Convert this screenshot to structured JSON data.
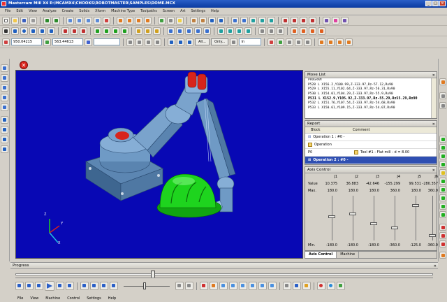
{
  "window": {
    "title": "Mastercam Mill X4   E:\\MCAMX4\\CHOOKS\\ROBOTMASTER\\SAMPLES\\DOME.MCX"
  },
  "menu": [
    "File",
    "Edit",
    "View",
    "Analyze",
    "Create",
    "Solids",
    "Xform",
    "Machine Type",
    "Toolpaths",
    "Screen",
    "Art",
    "Settings",
    "Help"
  ],
  "toolbar": {
    "coord_x": "950.04215",
    "coord_y": "563.44613",
    "field_all": "All...",
    "field_only": "Only...",
    "field_in": "In"
  },
  "movelist": {
    "title": "Move List",
    "header": "PROGRAM",
    "lines": [
      "P528 L X156.2,Y100.99,Z-333.97,Rz-57.12,Rx90",
      "P529 L X155.11,Y102.64,Z-333.97,Rz-56.31,Rx90",
      "P530 L X154.01,Y104.29,Z-333.97,Rz-55.9,Rx90",
      "P531 L X152.9,Y105.92,Z-333.97,Rz-55.29,Rx55.29,Rx90",
      "P532 L X151.76,Y107.54,Z-333.97,Rz-54.68,Rx90",
      "P533 L X150.61,Y109.15,Z-333.97,Rz-54.07,Rx90"
    ],
    "current_index": 3
  },
  "report": {
    "title": "Report",
    "col_block": "Block",
    "col_comment": "Comment",
    "group": "Operation 1 : #0 -",
    "op_label": "Operation",
    "p0": "P0",
    "tool": "Tool #1 - Flat mill - d = 8.00",
    "selected": "Operation 2 : #0 -"
  },
  "axis": {
    "title": "Axis Control",
    "joints": [
      "J1",
      "J2",
      "J3",
      "J4",
      "J5",
      "J6"
    ],
    "value_label": "Value",
    "values": [
      "10.375",
      "36.883",
      "-42.646",
      "-155.299",
      "99.531",
      "-280.357"
    ],
    "max_label": "Max.",
    "max": [
      "180.0",
      "180.0",
      "180.0",
      "360.0",
      "180.0",
      "360.0"
    ],
    "min_label": "Min.",
    "min": [
      "-180.0",
      "-180.0",
      "-180.0",
      "-360.0",
      "-125.0",
      "-360.0"
    ],
    "slider_fraction": [
      0.53,
      0.6,
      0.38,
      0.28,
      0.78,
      0.11
    ]
  },
  "axis_tabs": [
    "Axis Control",
    "Machine"
  ],
  "progress": {
    "title": "Progress",
    "fraction": 0.33
  },
  "viewport_axes": {
    "z": "Z",
    "y": "Y",
    "x": "X"
  },
  "bottom_menu": [
    "File",
    "View",
    "Machine",
    "Control",
    "Settings",
    "Help"
  ],
  "colors": {
    "viewport": "#0808b4",
    "robot": "#6fa0cc",
    "part": "#1ed41e",
    "selection": "#2f4fb2"
  },
  "icons": [
    "stop-icon",
    "play-icon",
    "rewind-icon",
    "fast-forward-icon"
  ]
}
